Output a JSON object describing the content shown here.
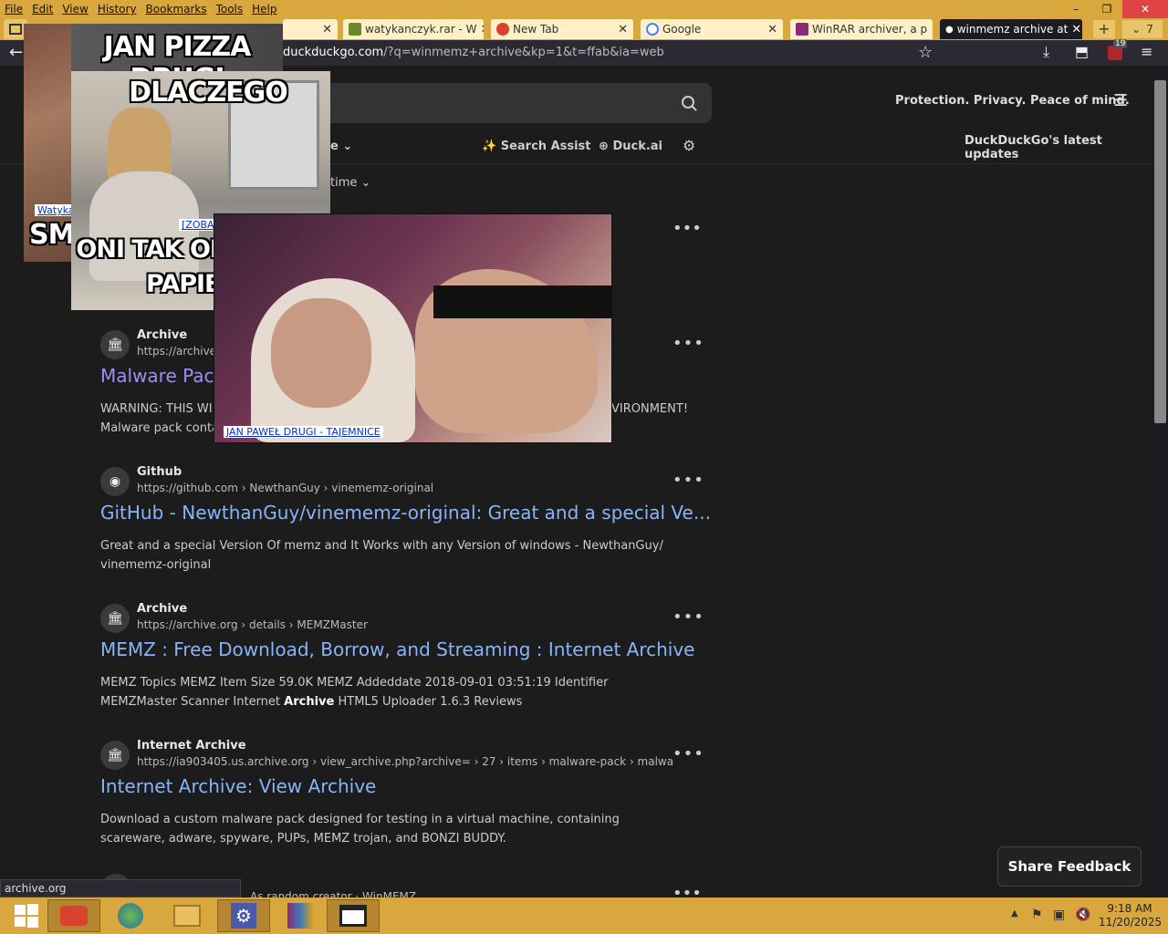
{
  "menubar": {
    "items": [
      "File",
      "Edit",
      "View",
      "History",
      "Bookmarks",
      "Tools",
      "Help"
    ]
  },
  "window_controls": {
    "minimize": "–",
    "restore": "❐",
    "close": "✕"
  },
  "tabs": [
    {
      "label": "watykanczyk.rar - W",
      "icon": "frog-icon"
    },
    {
      "label": "New Tab",
      "icon": "redfox-icon"
    },
    {
      "label": "Google",
      "icon": "google-icon"
    },
    {
      "label": "WinRAR archiver, a p",
      "icon": "winrar-icon"
    },
    {
      "label": "winmemz archive at",
      "icon": "dot-icon",
      "active": true
    }
  ],
  "tab_count": "7",
  "addressbar": {
    "url_domain": "duckduckgo.com",
    "url_rest": "/?q=winmemz+archive&kp=1&t=ffab&ia=web",
    "extension_badge": "19"
  },
  "ddg": {
    "tagline": "Protection. Privacy. Peace of mind.",
    "search_assist": "Search Assist",
    "duck_ai": "Duck.ai",
    "updates": "DuckDuckGo's latest updates",
    "time_filter": "time",
    "region_filter": "e"
  },
  "results": [
    {
      "site": "Archive",
      "url": "https://archive",
      "title": "Malware Pack",
      "snippet_l1": "WARNING: THIS WI",
      "snippet_l1_end": "VIRONMENT!",
      "snippet_l2": "Malware pack conta",
      "icon": "archive-icon"
    },
    {
      "site": "Github",
      "url": "https://github.com › NewthanGuy › vinememz-original",
      "title": "GitHub - NewthanGuy/vinememz-original: Great and a special Ve...",
      "snippet": "Great and a special Version Of memz and It Works with any Version of windows - NewthanGuy/ vinememz-original",
      "icon": "github-icon"
    },
    {
      "site": "Archive",
      "url": "https://archive.org › details › MEMZMaster",
      "title": "MEMZ : Free Download, Borrow, and Streaming : Internet Archive",
      "snippet_pre": "MEMZ Topics MEMZ Item Size 59.0K MEMZ Addeddate 2018-09-01 03:51:19 Identifier MEMZMaster Scanner Internet ",
      "snippet_bold": "Archive",
      "snippet_post": " HTML5 Uploader 1.6.3 Reviews",
      "icon": "archive-icon"
    },
    {
      "site": "Internet Archive",
      "url": "https://ia903405.us.archive.org › view_archive.php?archive= › 27 › items › malware-pack › malwar...",
      "title": "Internet Archive: View Archive",
      "snippet": "Download a custom malware pack designed for testing in a virtual machine, containing scareware, adware, spyware, PUPs, MEMZ trojan, and BONZI BUDDY.",
      "icon": "archive-icon"
    }
  ],
  "partial_result": "As random creator · WinMEMZ",
  "overlays": {
    "meme1_top1": "JAN PIZZA DRUGI",
    "meme1_top2": "DLACZEGO",
    "meme1_bottom1": "ONI TAK OBRAŻAJĄ",
    "meme1_bottom2": "PAPIEŻA",
    "meme1_link": "[ZOBACZ]",
    "meme0_link": "Watyka",
    "meme0_text": "SMA",
    "meme2_link": "JAN PAWEŁ DRUGI - TAJEMNICE"
  },
  "status_text": "archive.org",
  "share_feedback": "Share Feedback",
  "clock": {
    "time": "9:18 AM",
    "date": "11/20/2025"
  }
}
